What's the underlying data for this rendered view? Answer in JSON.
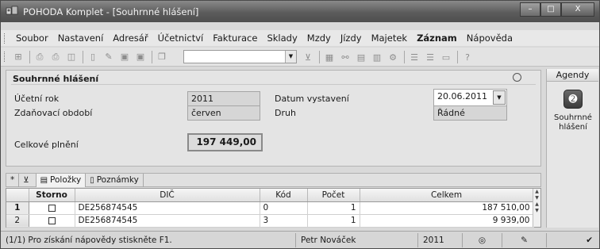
{
  "window": {
    "title": "POHODA Komplet - [Souhrnné hlášení]",
    "minimize": "–",
    "maximize": "□",
    "close": "X"
  },
  "menu": [
    "Soubor",
    "Nastavení",
    "Adresář",
    "Účetnictví",
    "Fakturace",
    "Sklady",
    "Mzdy",
    "Jízdy",
    "Majetek",
    "Záznam",
    "Nápověda"
  ],
  "form": {
    "title": "Souhrnné hlášení",
    "ucetni_rok_label": "Účetní rok",
    "ucetni_rok_value": "2011",
    "zdanovaci_obdobi_label": "Zdaňovací období",
    "zdanovaci_obdobi_value": "červen",
    "datum_vystaveni_label": "Datum vystavení",
    "datum_vystaveni_value": "20.06.2011",
    "druh_label": "Druh",
    "druh_value": "Řádné",
    "celkove_plneni_label": "Celkové plnění",
    "celkove_plneni_value": "197 449,00"
  },
  "agenda": {
    "header": "Agendy",
    "item_label_1": "Souhrnné",
    "item_label_2": "hlášení"
  },
  "tabs": {
    "star": "*",
    "polozky": "Položky",
    "poznamky": "Poznámky"
  },
  "grid": {
    "columns": [
      "",
      "Storno",
      "DIČ",
      "Kód",
      "Počet",
      "Celkem"
    ],
    "rows": [
      {
        "rn": "1",
        "dic": "DE256874545",
        "kod": "0",
        "pocet": "1",
        "celkem": "187 510,00"
      },
      {
        "rn": "2",
        "dic": "DE256874545",
        "kod": "3",
        "pocet": "1",
        "celkem": "9 939,00"
      }
    ]
  },
  "status": {
    "help": "(1/1) Pro získání nápovědy stiskněte F1.",
    "user": "Petr Nováček",
    "year": "2011"
  }
}
